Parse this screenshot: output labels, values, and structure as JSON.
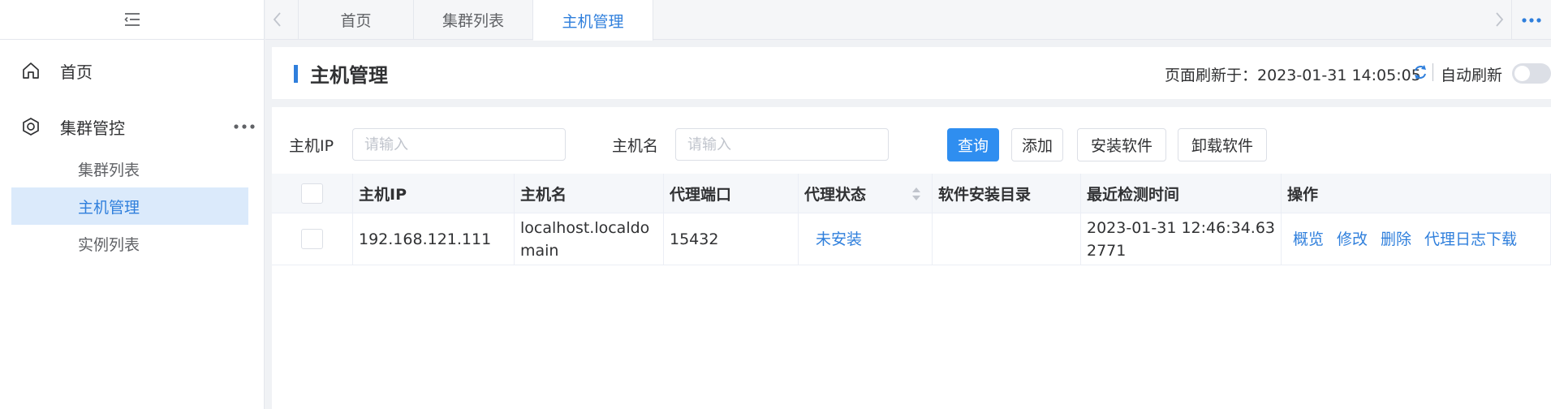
{
  "sidebar": {
    "items": [
      {
        "label": "首页",
        "icon": "home-icon"
      },
      {
        "label": "集群管控",
        "icon": "cluster-icon"
      }
    ],
    "sub_items": [
      {
        "label": "集群列表"
      },
      {
        "label": "主机管理",
        "active": true
      },
      {
        "label": "实例列表"
      }
    ]
  },
  "tabs": [
    {
      "label": "首页"
    },
    {
      "label": "集群列表"
    },
    {
      "label": "主机管理",
      "active": true
    }
  ],
  "header": {
    "title": "主机管理",
    "refresh_text": "页面刷新于：2023-01-31 14:05:05",
    "auto_refresh_label": "自动刷新",
    "auto_refresh_on": false
  },
  "filters": {
    "ip_label": "主机IP",
    "ip_placeholder": "请输入",
    "name_label": "主机名",
    "name_placeholder": "请输入"
  },
  "buttons": {
    "query": "查询",
    "add": "添加",
    "install": "安装软件",
    "uninstall": "卸载软件"
  },
  "table": {
    "columns": [
      "主机IP",
      "主机名",
      "代理端口",
      "代理状态",
      "软件安装目录",
      "最近检测时间",
      "操作"
    ],
    "rows": [
      {
        "ip": "192.168.121.111",
        "hostname": "localhost.localdomain",
        "port": "15432",
        "status": "未安装",
        "install_dir": "",
        "last_check": "2023-01-31 12:46:34.632771",
        "actions": [
          "概览",
          "修改",
          "删除",
          "代理日志下载"
        ]
      }
    ]
  },
  "colors": {
    "accent": "#2f7fdc",
    "primary_button": "#2f8ef0",
    "active_menu_bg": "#dbeafb"
  }
}
